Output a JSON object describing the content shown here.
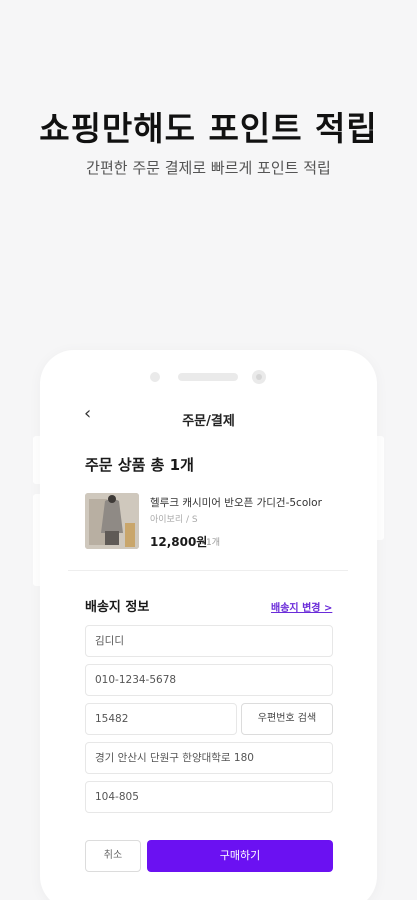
{
  "hero": {
    "title": "쇼핑만해도 포인트 적립",
    "subtitle": "간편한 주문 결제로 빠르게 포인트 적립"
  },
  "screen": {
    "back_icon": "‹",
    "title": "주문/결제",
    "order_section_title": "주문 상품 총 1개",
    "product": {
      "name": "헬루크 캐시미어 반오픈 가디건-5color",
      "option": "아이보리 / S",
      "price": "12,800원",
      "qty": "1개"
    },
    "shipping": {
      "title": "배송지 정보",
      "change_label": "배송지 변경 >",
      "name_value": "김디디",
      "phone_value": "010-1234-5678",
      "zip_value": "15482",
      "zip_search_label": "우편번호 검색",
      "address_value": "경기 안산시 단원구 한양대학로 180",
      "address_detail_value": "104-805"
    },
    "cancel_label": "취소",
    "buy_label": "구매하기"
  },
  "colors": {
    "accent": "#6b11f2",
    "link": "#6a2bd9",
    "background": "#f6f6f7"
  }
}
